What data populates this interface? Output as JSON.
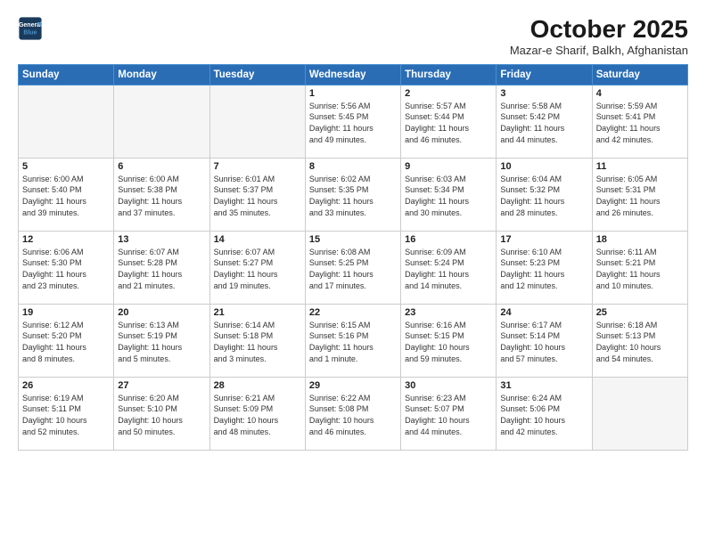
{
  "header": {
    "logo_line1": "General",
    "logo_line2": "Blue",
    "month": "October 2025",
    "location": "Mazar-e Sharif, Balkh, Afghanistan"
  },
  "weekdays": [
    "Sunday",
    "Monday",
    "Tuesday",
    "Wednesday",
    "Thursday",
    "Friday",
    "Saturday"
  ],
  "weeks": [
    [
      {
        "day": "",
        "info": ""
      },
      {
        "day": "",
        "info": ""
      },
      {
        "day": "",
        "info": ""
      },
      {
        "day": "1",
        "info": "Sunrise: 5:56 AM\nSunset: 5:45 PM\nDaylight: 11 hours\nand 49 minutes."
      },
      {
        "day": "2",
        "info": "Sunrise: 5:57 AM\nSunset: 5:44 PM\nDaylight: 11 hours\nand 46 minutes."
      },
      {
        "day": "3",
        "info": "Sunrise: 5:58 AM\nSunset: 5:42 PM\nDaylight: 11 hours\nand 44 minutes."
      },
      {
        "day": "4",
        "info": "Sunrise: 5:59 AM\nSunset: 5:41 PM\nDaylight: 11 hours\nand 42 minutes."
      }
    ],
    [
      {
        "day": "5",
        "info": "Sunrise: 6:00 AM\nSunset: 5:40 PM\nDaylight: 11 hours\nand 39 minutes."
      },
      {
        "day": "6",
        "info": "Sunrise: 6:00 AM\nSunset: 5:38 PM\nDaylight: 11 hours\nand 37 minutes."
      },
      {
        "day": "7",
        "info": "Sunrise: 6:01 AM\nSunset: 5:37 PM\nDaylight: 11 hours\nand 35 minutes."
      },
      {
        "day": "8",
        "info": "Sunrise: 6:02 AM\nSunset: 5:35 PM\nDaylight: 11 hours\nand 33 minutes."
      },
      {
        "day": "9",
        "info": "Sunrise: 6:03 AM\nSunset: 5:34 PM\nDaylight: 11 hours\nand 30 minutes."
      },
      {
        "day": "10",
        "info": "Sunrise: 6:04 AM\nSunset: 5:32 PM\nDaylight: 11 hours\nand 28 minutes."
      },
      {
        "day": "11",
        "info": "Sunrise: 6:05 AM\nSunset: 5:31 PM\nDaylight: 11 hours\nand 26 minutes."
      }
    ],
    [
      {
        "day": "12",
        "info": "Sunrise: 6:06 AM\nSunset: 5:30 PM\nDaylight: 11 hours\nand 23 minutes."
      },
      {
        "day": "13",
        "info": "Sunrise: 6:07 AM\nSunset: 5:28 PM\nDaylight: 11 hours\nand 21 minutes."
      },
      {
        "day": "14",
        "info": "Sunrise: 6:07 AM\nSunset: 5:27 PM\nDaylight: 11 hours\nand 19 minutes."
      },
      {
        "day": "15",
        "info": "Sunrise: 6:08 AM\nSunset: 5:25 PM\nDaylight: 11 hours\nand 17 minutes."
      },
      {
        "day": "16",
        "info": "Sunrise: 6:09 AM\nSunset: 5:24 PM\nDaylight: 11 hours\nand 14 minutes."
      },
      {
        "day": "17",
        "info": "Sunrise: 6:10 AM\nSunset: 5:23 PM\nDaylight: 11 hours\nand 12 minutes."
      },
      {
        "day": "18",
        "info": "Sunrise: 6:11 AM\nSunset: 5:21 PM\nDaylight: 11 hours\nand 10 minutes."
      }
    ],
    [
      {
        "day": "19",
        "info": "Sunrise: 6:12 AM\nSunset: 5:20 PM\nDaylight: 11 hours\nand 8 minutes."
      },
      {
        "day": "20",
        "info": "Sunrise: 6:13 AM\nSunset: 5:19 PM\nDaylight: 11 hours\nand 5 minutes."
      },
      {
        "day": "21",
        "info": "Sunrise: 6:14 AM\nSunset: 5:18 PM\nDaylight: 11 hours\nand 3 minutes."
      },
      {
        "day": "22",
        "info": "Sunrise: 6:15 AM\nSunset: 5:16 PM\nDaylight: 11 hours\nand 1 minute."
      },
      {
        "day": "23",
        "info": "Sunrise: 6:16 AM\nSunset: 5:15 PM\nDaylight: 10 hours\nand 59 minutes."
      },
      {
        "day": "24",
        "info": "Sunrise: 6:17 AM\nSunset: 5:14 PM\nDaylight: 10 hours\nand 57 minutes."
      },
      {
        "day": "25",
        "info": "Sunrise: 6:18 AM\nSunset: 5:13 PM\nDaylight: 10 hours\nand 54 minutes."
      }
    ],
    [
      {
        "day": "26",
        "info": "Sunrise: 6:19 AM\nSunset: 5:11 PM\nDaylight: 10 hours\nand 52 minutes."
      },
      {
        "day": "27",
        "info": "Sunrise: 6:20 AM\nSunset: 5:10 PM\nDaylight: 10 hours\nand 50 minutes."
      },
      {
        "day": "28",
        "info": "Sunrise: 6:21 AM\nSunset: 5:09 PM\nDaylight: 10 hours\nand 48 minutes."
      },
      {
        "day": "29",
        "info": "Sunrise: 6:22 AM\nSunset: 5:08 PM\nDaylight: 10 hours\nand 46 minutes."
      },
      {
        "day": "30",
        "info": "Sunrise: 6:23 AM\nSunset: 5:07 PM\nDaylight: 10 hours\nand 44 minutes."
      },
      {
        "day": "31",
        "info": "Sunrise: 6:24 AM\nSunset: 5:06 PM\nDaylight: 10 hours\nand 42 minutes."
      },
      {
        "day": "",
        "info": ""
      }
    ]
  ]
}
